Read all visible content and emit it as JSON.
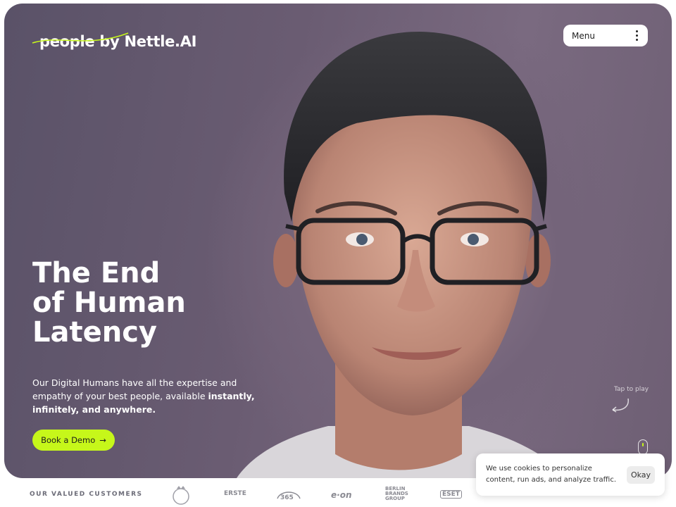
{
  "brand": {
    "logo_text": "people by Nettle.AI"
  },
  "nav": {
    "menu_label": "Menu"
  },
  "hero": {
    "title_lines": [
      "The End",
      "of Human",
      "Latency"
    ],
    "subtitle_plain": "Our Digital Humans have all the expertise and empathy of your best people, available ",
    "subtitle_bold": "instantly, infinitely, and anywhere.",
    "cta_label": "Book a Demo",
    "tap_hint": "Tap to play"
  },
  "customers": {
    "label": "OUR VALUED CUSTOMERS",
    "logos": [
      "ERSTE",
      "365",
      "e·on",
      "BERLIN BRANDS GROUP",
      "ESET"
    ]
  },
  "cookie": {
    "text": "We use cookies to personalize content, run ads, and analyze traffic.",
    "ok_label": "Okay"
  },
  "colors": {
    "accent": "#c6f71a",
    "hero_bg": "#6a5c72"
  }
}
